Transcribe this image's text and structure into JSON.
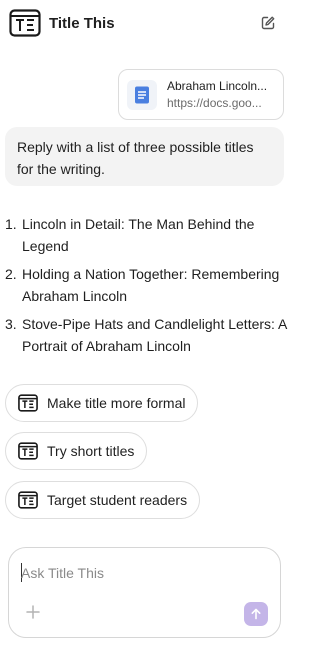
{
  "header": {
    "app_title": "Title This",
    "logo_icon": "text-cursor-logo-icon",
    "edit_icon": "edit-square-icon"
  },
  "attachment": {
    "icon": "google-docs-icon",
    "title": "Abraham Lincoln...",
    "url": "https://docs.goo..."
  },
  "user_message": {
    "text": "Reply with a list of three possible titles for the writing."
  },
  "answer": {
    "items": [
      {
        "num": "1.",
        "text": "Lincoln in Detail: The Man Behind the Legend"
      },
      {
        "num": "2.",
        "text": "Holding a Nation Together: Remembering Abraham Lincoln"
      },
      {
        "num": "3.",
        "text": "Stove-Pipe Hats and Candlelight Letters: A Portrait of Abraham Lincoln"
      }
    ]
  },
  "suggestions": [
    {
      "label": "Make title more formal",
      "icon": "text-cursor-icon"
    },
    {
      "label": "Try short titles",
      "icon": "text-cursor-icon"
    },
    {
      "label": "Target student readers",
      "icon": "text-cursor-icon"
    }
  ],
  "composer": {
    "placeholder": "Ask Title This",
    "plus_icon": "plus-icon",
    "send_icon": "arrow-up-icon",
    "send_color": "#c4b5e8"
  }
}
